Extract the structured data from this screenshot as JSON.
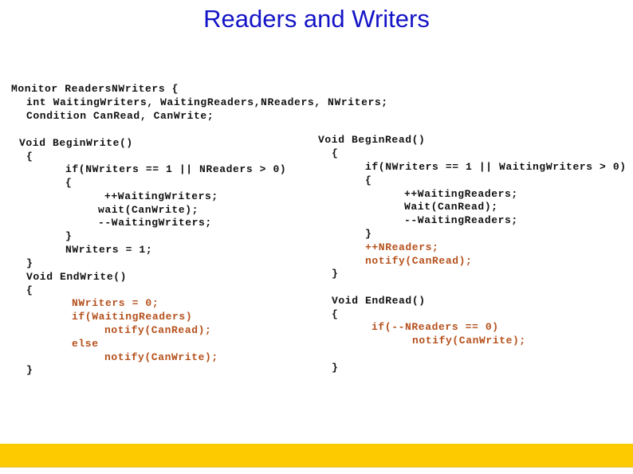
{
  "slide": {
    "title": "Readers and Writers",
    "colors": {
      "title": "#1414c8",
      "code": "#111111",
      "highlight": "#b5501c",
      "footer_bar": "#fdca00",
      "background": "#ffffff"
    },
    "monitor_header": [
      "Monitor ReadersNWriters {",
      "int WaitingWriters, WaitingReaders,NReaders, NWriters;",
      "Condition CanRead, CanWrite;"
    ],
    "begin_write": [
      "Void BeginWrite()",
      "{",
      "if(NWriters == 1 || NReaders > 0)",
      "{",
      "++WaitingWriters;",
      "wait(CanWrite);",
      "--WaitingWriters;",
      "}",
      "NWriters = 1;",
      "}"
    ],
    "end_write": [
      "Void EndWrite()",
      "{",
      "NWriters = 0;",
      "if(WaitingReaders)",
      "notify(CanRead);",
      "else",
      "notify(CanWrite);",
      "}"
    ],
    "begin_read": [
      "Void BeginRead()",
      "{",
      "if(NWriters == 1 || WaitingWriters > 0)",
      "{",
      "++WaitingReaders;",
      "Wait(CanRead);",
      "--WaitingReaders;",
      "}",
      "++NReaders;",
      "notify(CanRead);",
      "}"
    ],
    "end_read": [
      "Void EndRead()",
      "{",
      "if(--NReaders == 0)",
      "notify(CanWrite);",
      "}"
    ]
  }
}
